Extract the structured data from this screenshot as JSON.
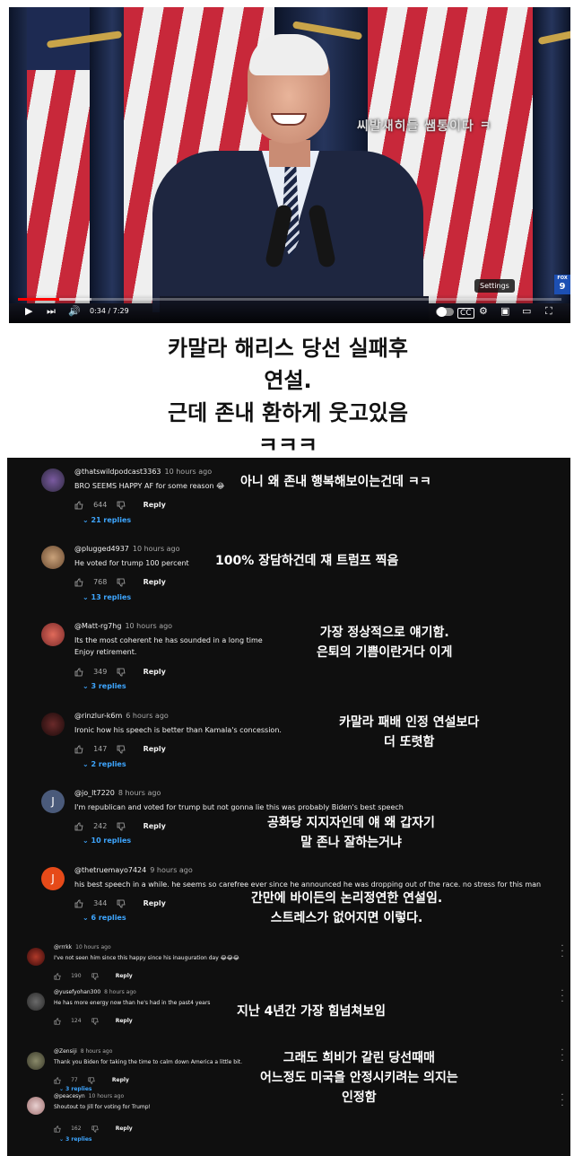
{
  "video": {
    "overlay_text": "씨발새히들 쌤통이다 ㅋ",
    "settings_tooltip": "Settings",
    "channel_badge_top": "FOX",
    "channel_badge_num": "9",
    "time": "0:34 / 7:29",
    "progress_fraction": 0.076
  },
  "caption": {
    "line1": "카말라 해리스 당선 실패후",
    "line2": "연설.",
    "line3": "근데 존내 환하게 웃고있음",
    "line4": "ㅋㅋㅋ"
  },
  "comments": [
    {
      "handle": "@thatswildpodcast3363",
      "ago": "10 hours ago",
      "text": "BRO SEEMS HAPPY AF for some reason 😂",
      "likes": "644",
      "reply": "Reply",
      "replies": "21 replies",
      "ko": [
        "아니 왜 존내 행복해보이는건데 ㅋㅋ"
      ]
    },
    {
      "handle": "@plugged4937",
      "ago": "10 hours ago",
      "text": "He voted for trump 100 percent",
      "likes": "768",
      "reply": "Reply",
      "replies": "13 replies",
      "ko": [
        "100% 장담하건데 쟤 트럼프 찍음"
      ]
    },
    {
      "handle": "@Matt-rg7hg",
      "ago": "10 hours ago",
      "text": "Its the most coherent he has sounded in a long time",
      "text2": "Enjoy retirement.",
      "likes": "349",
      "reply": "Reply",
      "replies": "3 replies",
      "ko": [
        "가장 정상적으로 얘기함.",
        "은퇴의 기쁨이란거다 이게"
      ]
    },
    {
      "handle": "@rinzlur-k6m",
      "ago": "6 hours ago",
      "text": "Ironic how his speech is better than Kamala's concession.",
      "likes": "147",
      "reply": "Reply",
      "replies": "2 replies",
      "ko": [
        "카말라 패배 인정 연설보다",
        "더 또렷함"
      ]
    },
    {
      "handle": "@jo_lt7220",
      "ago": "8 hours ago",
      "text": "I'm republican and voted for trump but not gonna lie this was probably Biden's best speech",
      "likes": "242",
      "reply": "Reply",
      "replies": "10 replies",
      "avatar_letter": "J",
      "ko": [
        "공화당 지지자인데 얘 왜 갑자기",
        "말 존나 잘하는거냐"
      ]
    },
    {
      "handle": "@thetruemayo7424",
      "ago": "9 hours ago",
      "text": "his best speech in a while. he seems so carefree ever since he announced he was dropping out of the race. no stress for this man",
      "likes": "344",
      "reply": "Reply",
      "replies": "6 replies",
      "avatar_letter": "J",
      "ko": [
        "간만에 바이든의 논리정연한 연설임.",
        "스트레스가 없어지면 이렇다."
      ]
    },
    {
      "handle": "@rrrkk",
      "ago": "10 hours ago",
      "text": "I've not seen him since this happy since his inauguration day 😂😂😂",
      "likes": "190",
      "reply": "Reply"
    },
    {
      "handle": "@yusefyohan300",
      "ago": "8 hours ago",
      "text": "He has more energy now than he's had in the past4 years",
      "likes": "124",
      "reply": "Reply",
      "ko": [
        "지난 4년간 가장 힘넘쳐보임"
      ]
    },
    {
      "handle": "@Zensiji",
      "ago": "8 hours ago",
      "text": "Thank you Biden for taking the time to calm down America a little bit.",
      "likes": "77",
      "reply": "Reply",
      "replies": "3 replies",
      "ko": [
        "그래도 희비가 갈린 당선때매",
        "어느정도 미국을 안정시키려는 의지는",
        "인정함"
      ]
    },
    {
      "handle": "@peacesyn",
      "ago": "10 hours ago",
      "text": "Shoutout to Jill for voting for Trump!",
      "likes": "162",
      "reply": "Reply",
      "replies": "3 replies"
    }
  ],
  "colors": {
    "link_blue": "#3ea6ff",
    "progress_red": "#ff0000",
    "comments_bg": "#0f0f0f",
    "avatar_red": "#e64a19",
    "avatar_blue": "#4a5a7a"
  }
}
